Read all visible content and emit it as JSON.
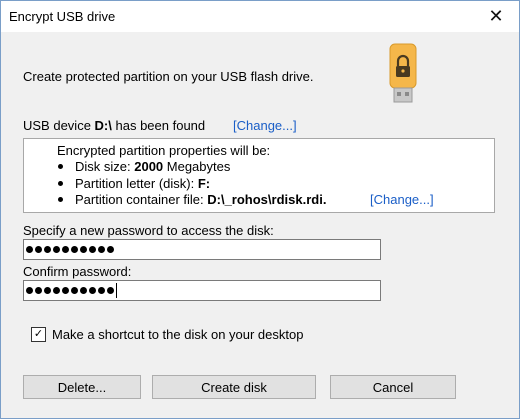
{
  "window": {
    "title": "Encrypt USB drive",
    "close_glyph": "✕"
  },
  "intro_text": "Create protected partition on your USB flash drive.",
  "usb": {
    "prefix": "USB device ",
    "drive": "D:\\",
    "suffix": " has been found",
    "change_link": "[Change...]"
  },
  "properties": {
    "heading": "Encrypted partition properties will be:",
    "disk_size_label": "Disk size: ",
    "disk_size_value": "2000",
    "disk_size_unit": " Megabytes",
    "letter_label": "Partition letter (disk): ",
    "letter_value": "F:",
    "container_label": "Partition container file: ",
    "container_value": "D:\\_rohos\\rdisk.rdi.",
    "change_link": "[Change...]"
  },
  "password": {
    "label": "Specify a new password to access the disk:",
    "dot_count": 10
  },
  "confirm": {
    "label": "Confirm password:",
    "dot_count": 10
  },
  "shortcut": {
    "label": "Make a shortcut to the disk on your desktop",
    "checked": true,
    "check_glyph": "✓"
  },
  "buttons": {
    "delete": "Delete...",
    "create": "Create disk",
    "cancel": "Cancel"
  },
  "icon": {
    "name": "usb-lock-icon",
    "color": "#f5b74a"
  }
}
